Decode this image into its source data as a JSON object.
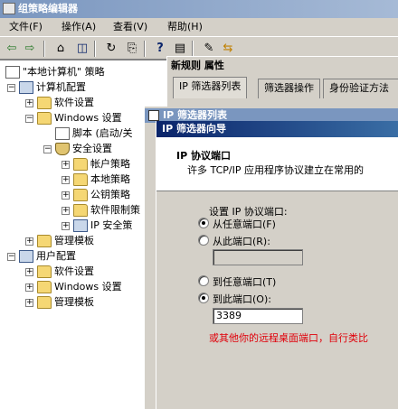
{
  "window": {
    "title": "组策略编辑器"
  },
  "menu": [
    {
      "label": "文件(F)"
    },
    {
      "label": "操作(A)"
    },
    {
      "label": "查看(V)"
    },
    {
      "label": "帮助(H)"
    }
  ],
  "toolbar": [
    {
      "icon": "back-arrow-icon",
      "glyph": "⇦"
    },
    {
      "icon": "forward-arrow-icon",
      "glyph": "⇨"
    },
    {
      "icon": "up-folder-icon",
      "glyph": "⌂"
    },
    {
      "icon": "show-hide-tree-icon",
      "glyph": "◫"
    },
    {
      "icon": "refresh-icon",
      "glyph": "↻"
    },
    {
      "icon": "export-list-icon",
      "glyph": "⎘"
    },
    {
      "icon": "help-icon",
      "glyph": "?"
    },
    {
      "icon": "properties-icon",
      "glyph": "▤"
    },
    {
      "icon": "new-policy-icon",
      "glyph": "✎"
    },
    {
      "icon": "assign-icon",
      "glyph": "⇆"
    }
  ],
  "tree": {
    "root": "\"本地计算机\" 策略",
    "computer_config": "计算机配置",
    "software_settings_1": "软件设置",
    "windows_settings_1": "Windows 设置",
    "scripts": "脚本 (启动/关",
    "security_settings": "安全设置",
    "account_policies": "帐户策略",
    "local_policies": "本地策略",
    "public_key_policies": "公钥策略",
    "software_restriction": "软件限制策",
    "ip_security": "IP 安全策",
    "admin_templates_1": "管理模板",
    "user_config": "用户配置",
    "software_settings_2": "软件设置",
    "windows_settings_2": "Windows 设置",
    "admin_templates_2": "管理模板"
  },
  "properties_dialog": {
    "title": "新规则 属性",
    "tabs": [
      "IP 筛选器列表",
      "筛选器操作",
      "身份验证方法"
    ]
  },
  "filter_list_dialog": {
    "title": "IP 筛选器列表"
  },
  "wizard": {
    "title": "IP 筛选器向导",
    "header_title": "IP 协议端口",
    "header_desc": "许多 TCP/IP 应用程序协议建立在常用的",
    "set_port_label": "设置 IP 协议端口:",
    "from_any_port": "从任意端口(F)",
    "from_this_port": "从此端口(R):",
    "from_port_value": "",
    "to_any_port": "到任意端口(T)",
    "to_this_port": "到此端口(O):",
    "to_port_value": "3389",
    "annotation": "或其他你的远程桌面端口，自行类比"
  }
}
